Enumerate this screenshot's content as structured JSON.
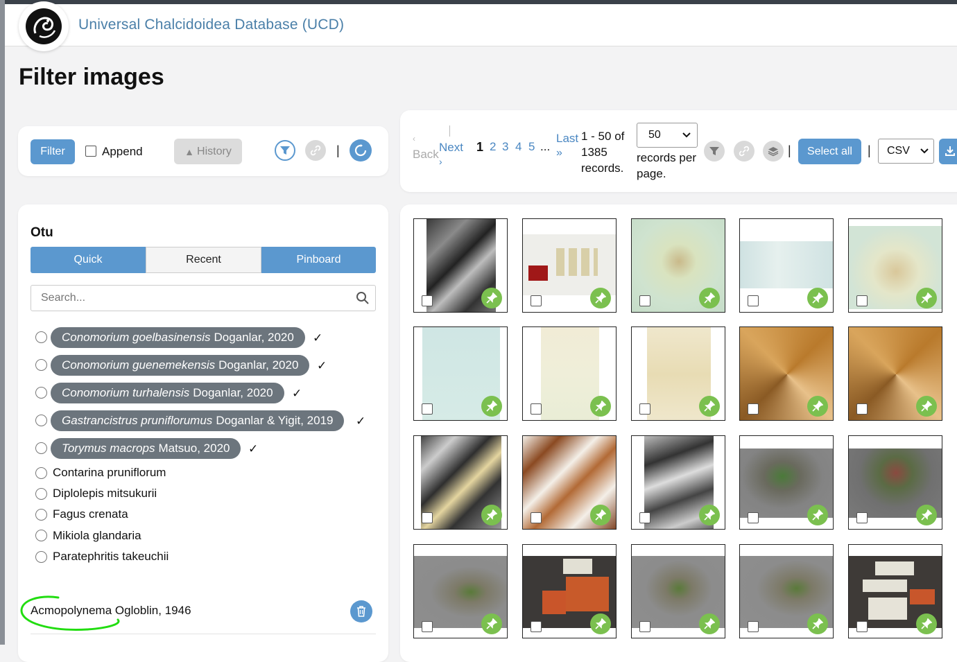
{
  "app": {
    "title": "Universal Chalcidoidea Database (UCD)"
  },
  "page": {
    "title": "Filter images"
  },
  "filter_bar": {
    "filter_label": "Filter",
    "append_label": "Append",
    "history_label": "History"
  },
  "otu_panel": {
    "heading": "Otu",
    "tabs": [
      {
        "label": "Quick",
        "active": true
      },
      {
        "label": "Recent",
        "active": false
      },
      {
        "label": "Pinboard",
        "active": true
      }
    ],
    "search_placeholder": "Search...",
    "pinned": [
      {
        "genus_species": "Conomorium goelbasinensis",
        "author": "Doganlar, 2020"
      },
      {
        "genus_species": "Conomorium guenemekensis",
        "author": "Doganlar, 2020"
      },
      {
        "genus_species": "Conomorium turhalensis",
        "author": "Doganlar, 2020"
      },
      {
        "genus_species": "Gastrancistrus pruniflorumus",
        "author": "Doganlar & Yigit, 2019"
      },
      {
        "genus_species": "Torymus macrops",
        "author": "Matsuo, 2020"
      }
    ],
    "checkmark": "✓",
    "plain": [
      "Contarina pruniflorum",
      "Diplolepis mitsukurii",
      "Fagus crenata",
      "Mikiola glandaria",
      "Paratephritis takeuchii"
    ],
    "selected": "Acmopolynema Ogloblin, 1946"
  },
  "pagination": {
    "back_label": "Back",
    "next_label": "Next",
    "pages": [
      "1",
      "2",
      "3",
      "4",
      "5"
    ],
    "ellipsis": "...",
    "last_label": "Last",
    "summary": "1 - 50 of 1385 records.",
    "per_page_value": "50",
    "per_page_label": "records per page.",
    "select_all_label": "Select all",
    "format_value": "CSV",
    "separator": "|"
  },
  "colors": {
    "accent": "#5b98cf",
    "pin": "#7bc04f",
    "pill": "#6c757d",
    "annotation": "#22dd11"
  }
}
